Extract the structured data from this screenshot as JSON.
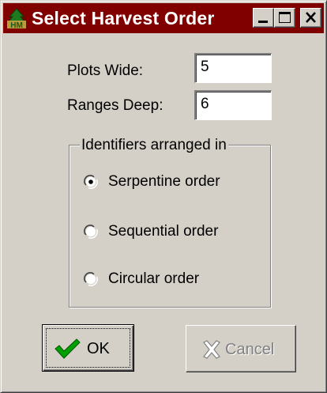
{
  "window": {
    "title": "Select Harvest Order",
    "icon_text": "HM"
  },
  "form": {
    "plots_wide_label": "Plots Wide:",
    "plots_wide_value": "5",
    "ranges_deep_label": "Ranges Deep:",
    "ranges_deep_value": "6"
  },
  "group": {
    "legend": "Identifiers arranged  in",
    "options": [
      {
        "label": "Serpentine order",
        "selected": true
      },
      {
        "label": "Sequential order",
        "selected": false
      },
      {
        "label": "Circular order",
        "selected": false
      }
    ]
  },
  "buttons": {
    "ok_label": "OK",
    "cancel_label": "Cancel",
    "cancel_enabled": false
  },
  "colors": {
    "titlebar": "#800000",
    "face": "#d4d0c8",
    "check_green": "#00a000"
  }
}
